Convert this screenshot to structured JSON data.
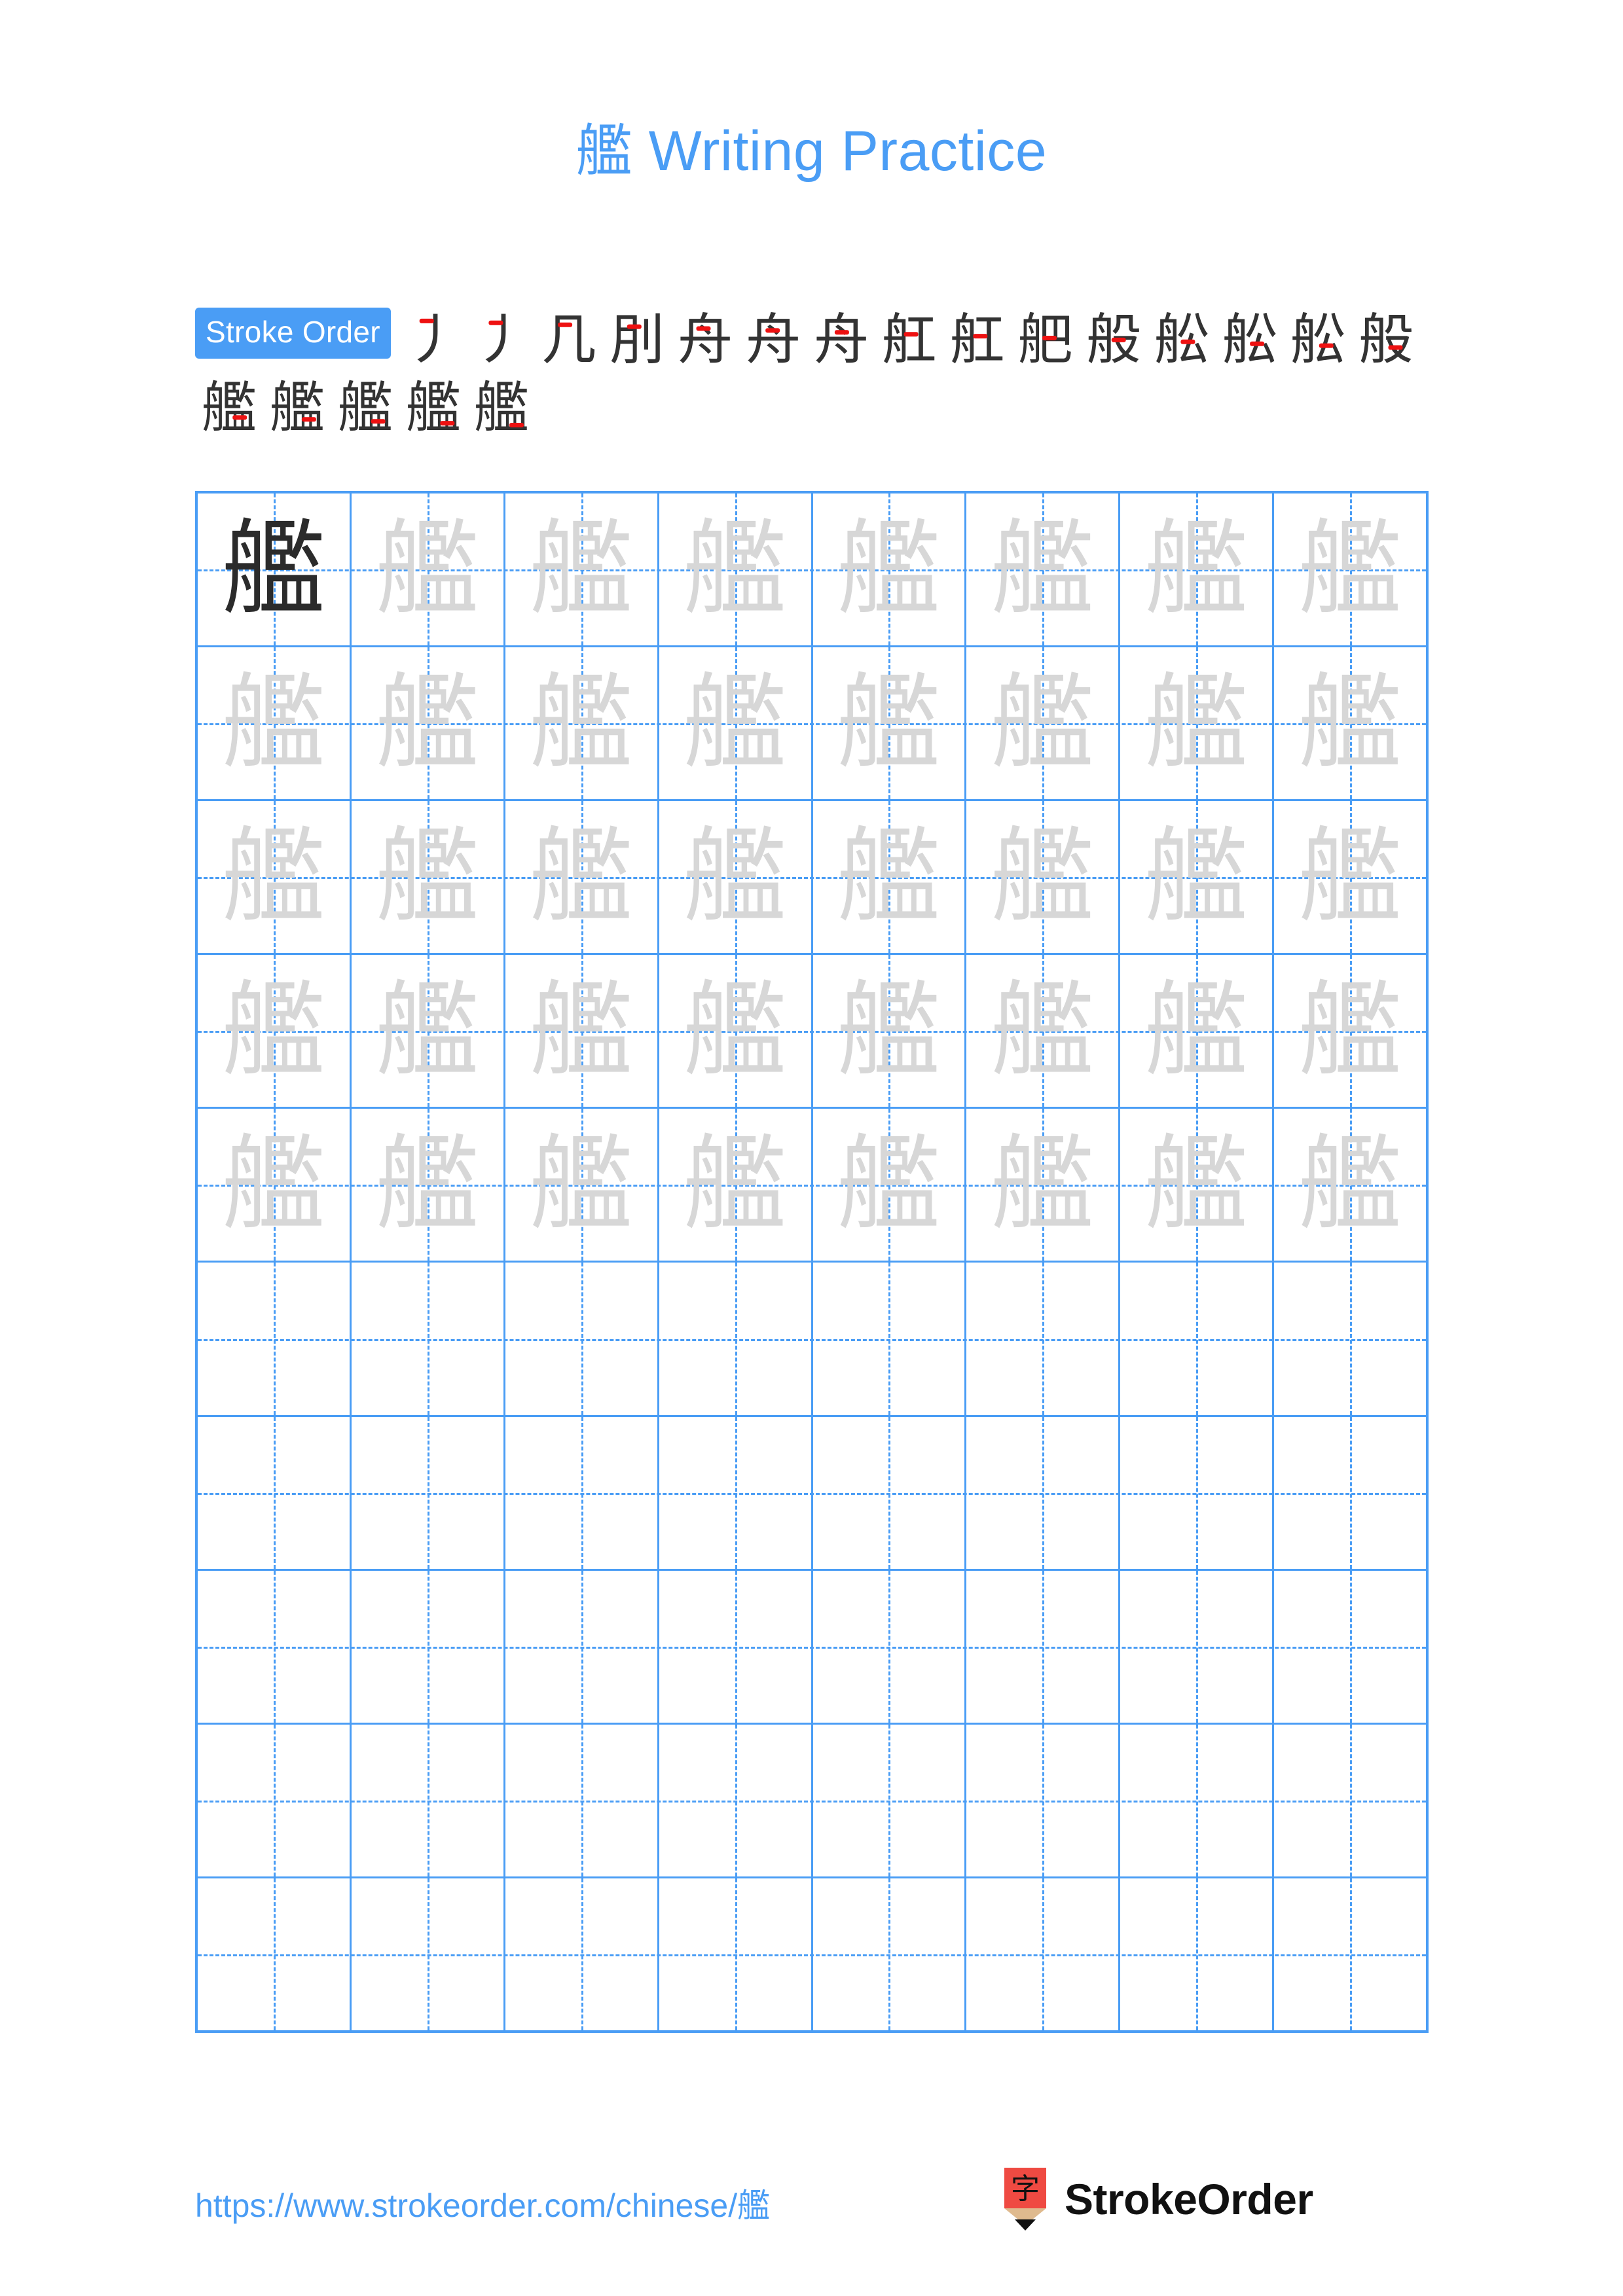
{
  "character": "艦",
  "header": {
    "title_char": "艦",
    "title_text": " Writing Practice",
    "title_color": "#4a9df5"
  },
  "stroke_order": {
    "label": "Stroke Order",
    "label_bg": "#4a9df5",
    "label_color": "#ffffff",
    "total_strokes": 20,
    "new_stroke_color": "#ee1111",
    "existing_stroke_color": "#333333",
    "steps": [
      {
        "index": 1,
        "glyph": "丿"
      },
      {
        "index": 2,
        "glyph": "丿"
      },
      {
        "index": 3,
        "glyph": "几"
      },
      {
        "index": 4,
        "glyph": "刖"
      },
      {
        "index": 5,
        "glyph": "舟"
      },
      {
        "index": 6,
        "glyph": "舟"
      },
      {
        "index": 7,
        "glyph": "舟"
      },
      {
        "index": 8,
        "glyph": "舡"
      },
      {
        "index": 9,
        "glyph": "舡"
      },
      {
        "index": 10,
        "glyph": "舥"
      },
      {
        "index": 11,
        "glyph": "般"
      },
      {
        "index": 12,
        "glyph": "舩"
      },
      {
        "index": 13,
        "glyph": "舩"
      },
      {
        "index": 14,
        "glyph": "舩"
      },
      {
        "index": 15,
        "glyph": "般"
      },
      {
        "index": 16,
        "glyph": "艦"
      },
      {
        "index": 17,
        "glyph": "艦"
      },
      {
        "index": 18,
        "glyph": "艦"
      },
      {
        "index": 19,
        "glyph": "艦"
      },
      {
        "index": 20,
        "glyph": "艦"
      }
    ]
  },
  "grid": {
    "columns": 8,
    "rows": 10,
    "border_color": "#4a9df5",
    "trace_color": "#d7d7d7",
    "model_color": "#2b2b2b",
    "cells": [
      [
        "dark",
        "trace",
        "trace",
        "trace",
        "trace",
        "trace",
        "trace",
        "trace"
      ],
      [
        "trace",
        "trace",
        "trace",
        "trace",
        "trace",
        "trace",
        "trace",
        "trace"
      ],
      [
        "trace",
        "trace",
        "trace",
        "trace",
        "trace",
        "trace",
        "trace",
        "trace"
      ],
      [
        "trace",
        "trace",
        "trace",
        "trace",
        "trace",
        "trace",
        "trace",
        "trace"
      ],
      [
        "trace",
        "trace",
        "trace",
        "trace",
        "trace",
        "trace",
        "trace",
        "trace"
      ],
      [
        "blank",
        "blank",
        "blank",
        "blank",
        "blank",
        "blank",
        "blank",
        "blank"
      ],
      [
        "blank",
        "blank",
        "blank",
        "blank",
        "blank",
        "blank",
        "blank",
        "blank"
      ],
      [
        "blank",
        "blank",
        "blank",
        "blank",
        "blank",
        "blank",
        "blank",
        "blank"
      ],
      [
        "blank",
        "blank",
        "blank",
        "blank",
        "blank",
        "blank",
        "blank",
        "blank"
      ],
      [
        "blank",
        "blank",
        "blank",
        "blank",
        "blank",
        "blank",
        "blank",
        "blank"
      ]
    ]
  },
  "footer": {
    "url": "https://www.strokeorder.com/chinese/艦",
    "url_color": "#4a9df5",
    "brand_name": "StrokeOrder",
    "logo_char": "字",
    "logo_body_color": "#ef4a42",
    "logo_wood_color": "#dfba8e",
    "logo_tip_color": "#111111"
  }
}
